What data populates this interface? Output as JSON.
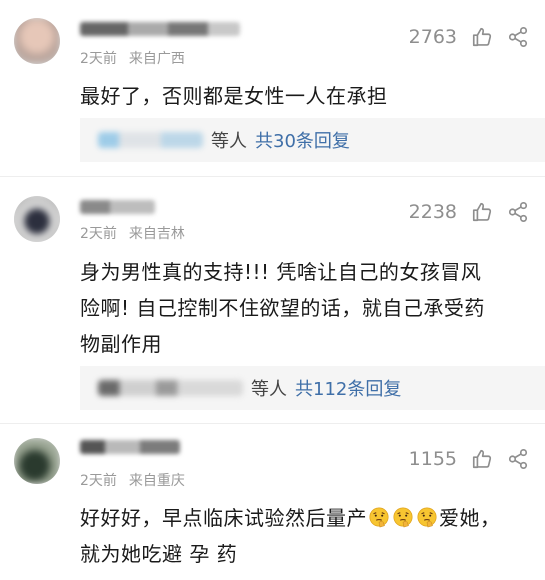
{
  "comments": [
    {
      "time": "2天前",
      "location": "来自广西",
      "likes": "2763",
      "text": "最好了，否则都是女性一人在承担",
      "reply": {
        "suffix": "等人",
        "link": "共30条回复"
      }
    },
    {
      "time": "2天前",
      "location": "来自吉林",
      "likes": "2238",
      "text_lines": [
        "身为男性真的支持!!! 凭啥让自己的女孩冒风",
        "险啊! 自己控制不住欲望的话，就自己承受药",
        "物副作用"
      ],
      "reply": {
        "suffix": "等人",
        "link": "共112条回复"
      }
    },
    {
      "time": "2天前",
      "location": "来自重庆",
      "likes": "1155",
      "text_before_emoji": "好好好，早点临床试验然后量产",
      "emoji_name": "thinking-face-emoji",
      "emoji_count": 3,
      "text_after_emoji": "爱她，",
      "text_line2": "就为她吃避 孕 药"
    }
  ],
  "colors": {
    "link": "#3f6fa8",
    "meta": "#9a9a9a",
    "reply_bg": "#f5f5f5"
  },
  "icons": [
    "thumbs-up-icon",
    "share-icon"
  ]
}
